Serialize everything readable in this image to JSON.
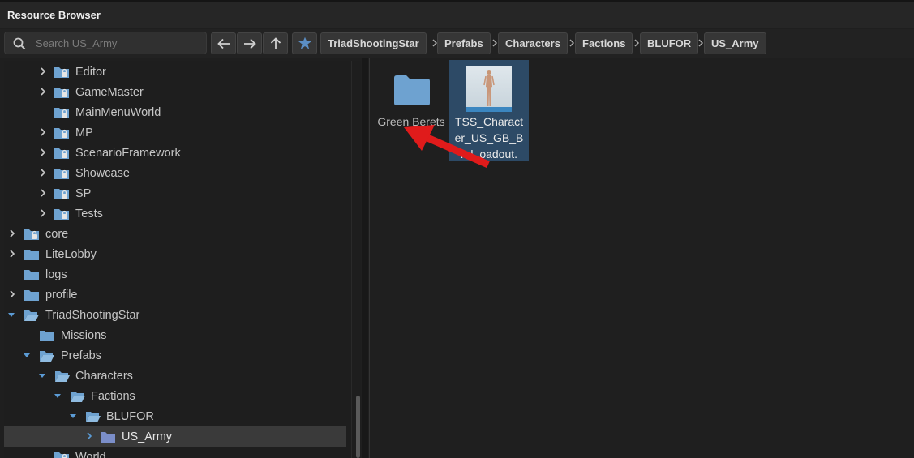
{
  "window": {
    "title": "Resource Browser"
  },
  "search": {
    "placeholder": "Search US_Army",
    "value": ""
  },
  "nav": {
    "back_icon": "arrow-left-icon",
    "forward_icon": "arrow-right-icon",
    "up_icon": "arrow-up-icon",
    "favorite_icon": "star-icon"
  },
  "breadcrumbs": [
    "TriadShootingStar",
    "Prefabs",
    "Characters",
    "Factions",
    "BLUFOR",
    "US_Army"
  ],
  "tree": {
    "items": [
      {
        "label": "Editor",
        "expandable": true,
        "expanded": false,
        "locked": true
      },
      {
        "label": "GameMaster",
        "expandable": true,
        "expanded": false,
        "locked": true
      },
      {
        "label": "MainMenuWorld",
        "expandable": false,
        "expanded": false,
        "locked": true
      },
      {
        "label": "MP",
        "expandable": true,
        "expanded": false,
        "locked": true
      },
      {
        "label": "ScenarioFramework",
        "expandable": true,
        "expanded": false,
        "locked": true
      },
      {
        "label": "Showcase",
        "expandable": true,
        "expanded": false,
        "locked": true
      },
      {
        "label": "SP",
        "expandable": true,
        "expanded": false,
        "locked": true
      },
      {
        "label": "Tests",
        "expandable": true,
        "expanded": false,
        "locked": true
      },
      {
        "label": "core",
        "expandable": true,
        "expanded": false,
        "locked": true
      },
      {
        "label": "LiteLobby",
        "expandable": true,
        "expanded": false,
        "locked": false
      },
      {
        "label": "logs",
        "expandable": false,
        "expanded": false,
        "locked": false
      },
      {
        "label": "profile",
        "expandable": true,
        "expanded": false,
        "locked": false
      },
      {
        "label": "TriadShootingStar",
        "expandable": true,
        "expanded": true,
        "locked": false
      },
      {
        "label": "Missions",
        "expandable": false,
        "expanded": false,
        "locked": false
      },
      {
        "label": "Prefabs",
        "expandable": true,
        "expanded": true,
        "locked": false
      },
      {
        "label": "Characters",
        "expandable": true,
        "expanded": true,
        "locked": false
      },
      {
        "label": "Factions",
        "expandable": true,
        "expanded": true,
        "locked": false
      },
      {
        "label": "BLUFOR",
        "expandable": true,
        "expanded": true,
        "locked": false
      },
      {
        "label": "US_Army",
        "expandable": true,
        "expanded": false,
        "locked": false,
        "selected": true
      },
      {
        "label": "World",
        "expandable": false,
        "expanded": false,
        "locked": true
      }
    ]
  },
  "content": {
    "items": [
      {
        "type": "folder",
        "name": "Green Berets",
        "icon": "folder-icon"
      },
      {
        "type": "prefab",
        "name_lines": [
          "TSS_Charact",
          "er_US_GB_B",
          "ral_oadout."
        ],
        "selected": true,
        "icon": "character-thumbnail"
      }
    ]
  },
  "colors": {
    "accent": "#5b8ec4",
    "folder": "#6ea2d0",
    "selection": "#2d4a66",
    "annotation_arrow": "#e01b1b"
  }
}
